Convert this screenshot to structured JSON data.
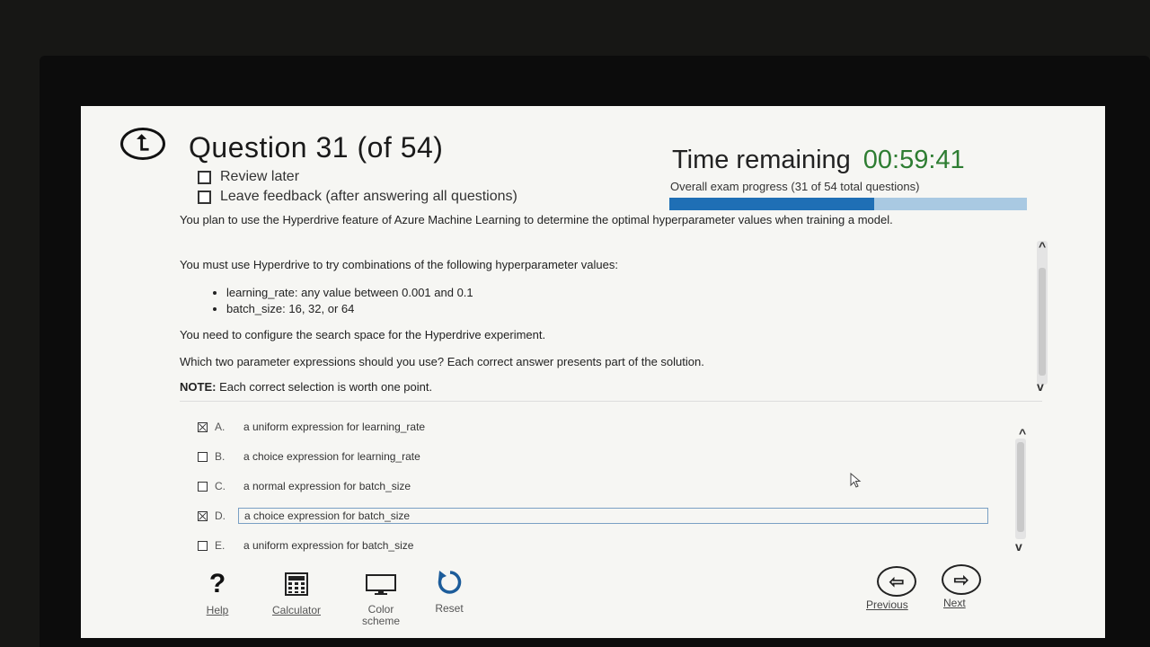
{
  "header": {
    "back_glyph": "⮤",
    "question_title": "Question 31 (of 54)",
    "review_later": "Review later",
    "leave_feedback": "Leave feedback (after answering all questions)"
  },
  "timer": {
    "label": "Time remaining",
    "value": "00:59:41",
    "value_color": "#2e7d32"
  },
  "progress": {
    "label": "Overall exam progress (31 of 54 total questions)",
    "answered": 31,
    "total": 54,
    "fill_color": "#1f6fb5",
    "track_color": "#a9c9e2"
  },
  "question": {
    "intro": "You plan to use the Hyperdrive feature of Azure Machine Learning to determine the optimal hyperparameter values when training a model.",
    "requirement": "You must use Hyperdrive to try combinations of the following hyperparameter values:",
    "bullets": [
      "learning_rate: any value between 0.001 and 0.1",
      "batch_size: 16, 32, or 64"
    ],
    "task": "You need to configure the search space for the Hyperdrive experiment.",
    "prompt": "Which two parameter expressions should you use? Each correct answer presents part of the solution.",
    "note_label": "NOTE:",
    "note_text": "Each correct selection is worth one point."
  },
  "options": [
    {
      "letter": "A.",
      "text": "a uniform expression for learning_rate",
      "checked": true
    },
    {
      "letter": "B.",
      "text": "a choice expression for learning_rate",
      "checked": false
    },
    {
      "letter": "C.",
      "text": "a normal expression for batch_size",
      "checked": false
    },
    {
      "letter": "D.",
      "text": "a choice expression for batch_size",
      "checked": true
    },
    {
      "letter": "E.",
      "text": "a uniform expression for batch_size",
      "checked": false
    }
  ],
  "toolbar": {
    "help_glyph": "?",
    "help": "Help",
    "calculator": "Calculator",
    "color_scheme": "Color scheme",
    "reset": "Reset",
    "previous": "Previous",
    "next": "Next",
    "previous_glyph": "⇦",
    "next_glyph": "⇨"
  }
}
